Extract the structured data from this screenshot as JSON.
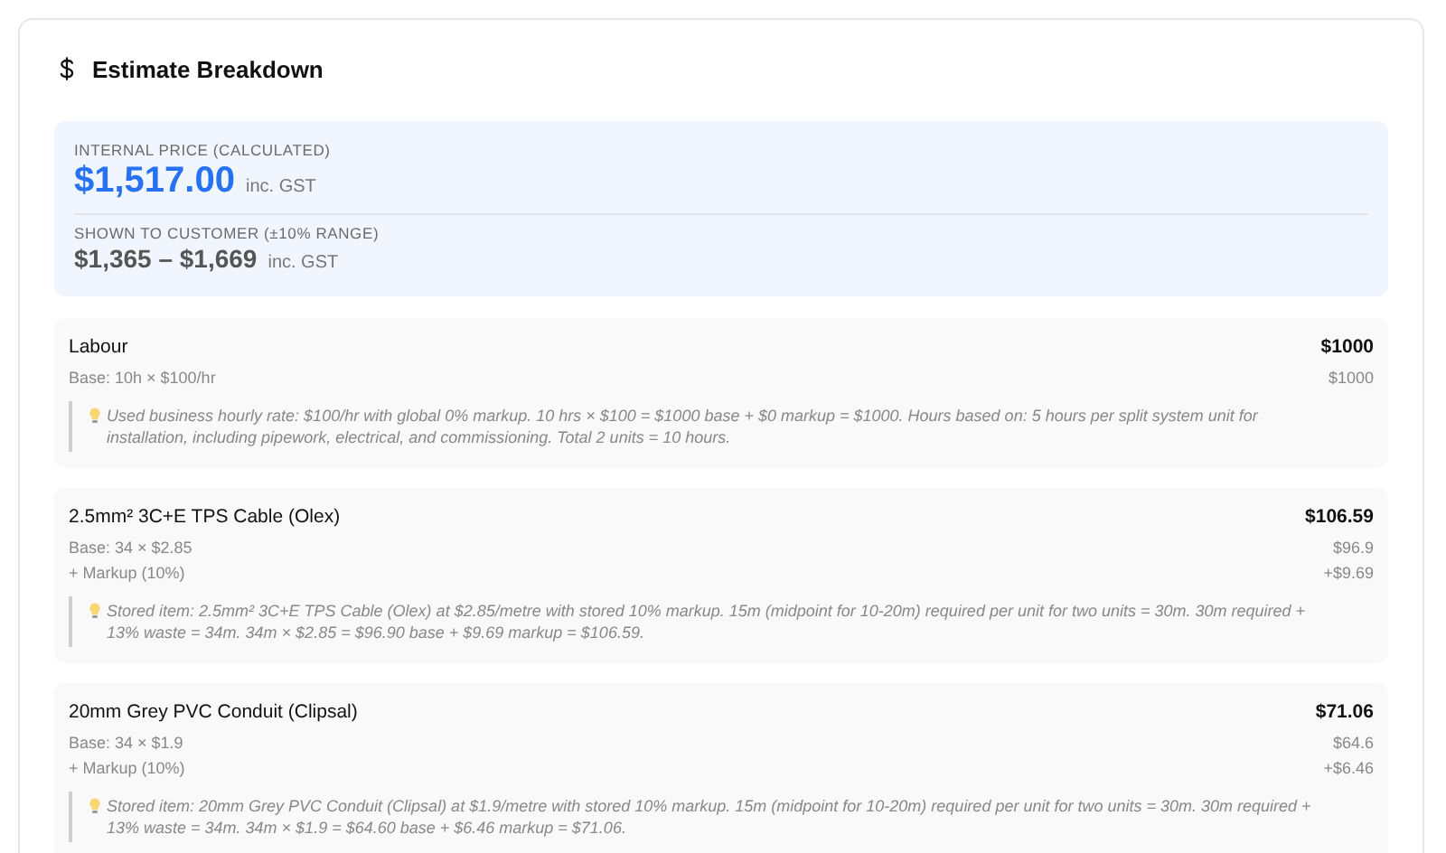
{
  "card": {
    "title": "Estimate Breakdown"
  },
  "summary": {
    "internal_label": "INTERNAL PRICE (CALCULATED)",
    "internal_price": "$1,517.00",
    "internal_suffix": "inc. GST",
    "customer_label": "SHOWN TO CUSTOMER (±10% RANGE)",
    "customer_range": "$1,365 – $1,669",
    "customer_suffix": "inc. GST"
  },
  "items": [
    {
      "name": "Labour",
      "total": "$1000",
      "lines": [
        {
          "label": "Base: 10h × $100/hr",
          "value": "$1000"
        }
      ],
      "note": "Used business hourly rate: $100/hr with global 0% markup. 10 hrs × $100 = $1000 base + $0 markup = $1000. Hours based on: 5 hours per split system unit for installation, including pipework, electrical, and commissioning. Total 2 units = 10 hours."
    },
    {
      "name": "2.5mm² 3C+E TPS Cable (Olex)",
      "total": "$106.59",
      "lines": [
        {
          "label": "Base: 34 × $2.85",
          "value": "$96.9"
        },
        {
          "label": "+ Markup (10%)",
          "value": "+$9.69"
        }
      ],
      "note": "Stored item: 2.5mm² 3C+E TPS Cable (Olex) at $2.85/metre with stored 10% markup. 15m (midpoint for 10-20m) required per unit for two units = 30m. 30m required + 13% waste = 34m. 34m × $2.85 = $96.90 base + $9.69 markup = $106.59."
    },
    {
      "name": "20mm Grey PVC Conduit (Clipsal)",
      "total": "$71.06",
      "lines": [
        {
          "label": "Base: 34 × $1.9",
          "value": "$64.6"
        },
        {
          "label": "+ Markup (10%)",
          "value": "+$6.46"
        }
      ],
      "note": "Stored item: 20mm Grey PVC Conduit (Clipsal) at $1.9/metre with stored 10% markup. 15m (midpoint for 10-20m) required per unit for two units = 30m. 30m required + 13% waste = 34m. 34m × $1.9 = $64.60 base + $6.46 markup = $71.06."
    }
  ]
}
